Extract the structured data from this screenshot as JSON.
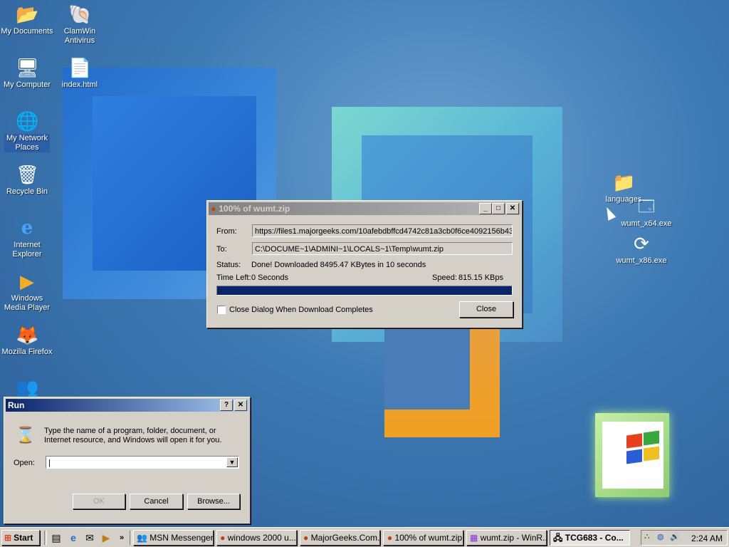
{
  "desktop_icons": [
    {
      "label": "My Documents",
      "icon": "folder-icon"
    },
    {
      "label": "ClamWin Antivirus",
      "icon": "clamwin-icon"
    },
    {
      "label": "My Computer",
      "icon": "computer-icon"
    },
    {
      "label": "index.html",
      "icon": "ie-document-icon"
    },
    {
      "label": "My Network Places",
      "icon": "network-icon"
    },
    {
      "label": "Recycle Bin",
      "icon": "recycle-bin-icon"
    },
    {
      "label": "Internet Explorer",
      "icon": "ie-icon"
    },
    {
      "label": "Windows Media Player",
      "icon": "media-player-icon"
    },
    {
      "label": "Mozilla Firefox",
      "icon": "firefox-icon"
    },
    {
      "label": "languages",
      "icon": "folder-icon"
    },
    {
      "label": "wumt_x64.exe",
      "icon": "window-app-icon"
    },
    {
      "label": "wumt_x86.exe",
      "icon": "update-icon"
    }
  ],
  "download_dialog": {
    "title": "100% of wumt.zip",
    "from_label": "From:",
    "from_value": "https://files1.majorgeeks.com/10afebdbffcd4742c81a3cb0f6ce4092156b43",
    "to_label": "To:",
    "to_value": "C:\\DOCUME~1\\ADMINI~1\\LOCALS~1\\Temp\\wumt.zip",
    "status_label": "Status:",
    "status_value": "Done! Downloaded 8495.47 KBytes in 10 seconds",
    "time_left_label": "Time Left:",
    "time_left_value": "0 Seconds",
    "speed_label": "Speed:",
    "speed_value": "815.15 KBps",
    "progress": 1.0,
    "checkbox_label": "Close Dialog When Download Completes",
    "checkbox_checked": false,
    "close_button": "Close"
  },
  "run_dialog": {
    "title": "Run",
    "description_line1": "Type the name of a program, folder, document, or",
    "description_line2": "Internet resource, and Windows will open it for you.",
    "open_label": "Open:",
    "open_value": "",
    "ok_button": "OK",
    "cancel_button": "Cancel",
    "browse_button": "Browse..."
  },
  "taskbar": {
    "start_label": "Start",
    "tasks": [
      {
        "label": "MSN Messenger",
        "icon": "msn-icon"
      },
      {
        "label": "windows 2000 u...",
        "icon": "firefox-icon"
      },
      {
        "label": "MajorGeeks.Com...",
        "icon": "firefox-icon"
      },
      {
        "label": "100% of wumt.zip",
        "icon": "firefox-icon"
      },
      {
        "label": "wumt.zip - WinR...",
        "icon": "winrar-icon"
      },
      {
        "label": "TCG683 - Co...",
        "icon": "remote-icon"
      }
    ],
    "clock": "2:24 AM"
  }
}
